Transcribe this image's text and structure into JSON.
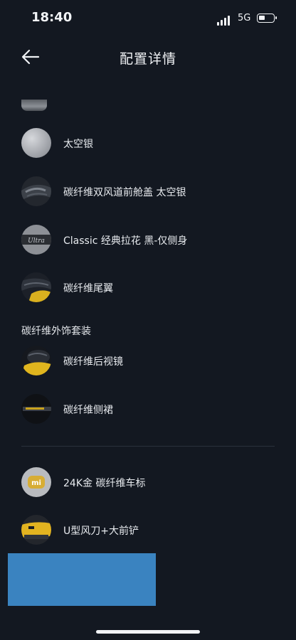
{
  "status_bar": {
    "time": "18:40",
    "network": "5G"
  },
  "header": {
    "title": "配置详情"
  },
  "items_top": [
    {
      "label": "太空银",
      "icon": "silver-swatch"
    },
    {
      "label": "碳纤维双风道前舱盖 太空银",
      "icon": "hood-image"
    },
    {
      "label": "Classic 经典拉花 黑-仅侧身",
      "icon": "decal-image"
    },
    {
      "label": "碳纤维尾翼",
      "icon": "wing-image"
    }
  ],
  "section_title": "碳纤维外饰套装",
  "items_kit": [
    {
      "label": "碳纤维后视镜",
      "icon": "mirror-image"
    },
    {
      "label": "碳纤维侧裙",
      "icon": "side-skirt-image"
    }
  ],
  "items_bottom": [
    {
      "label": "24K金 碳纤维车标",
      "icon": "badge-image"
    },
    {
      "label": "U型风刀+大前铲",
      "icon": "front-splitter-image"
    }
  ],
  "colors": {
    "background": "#131821",
    "text": "#e8ebef",
    "redaction": "#3a83c0"
  }
}
